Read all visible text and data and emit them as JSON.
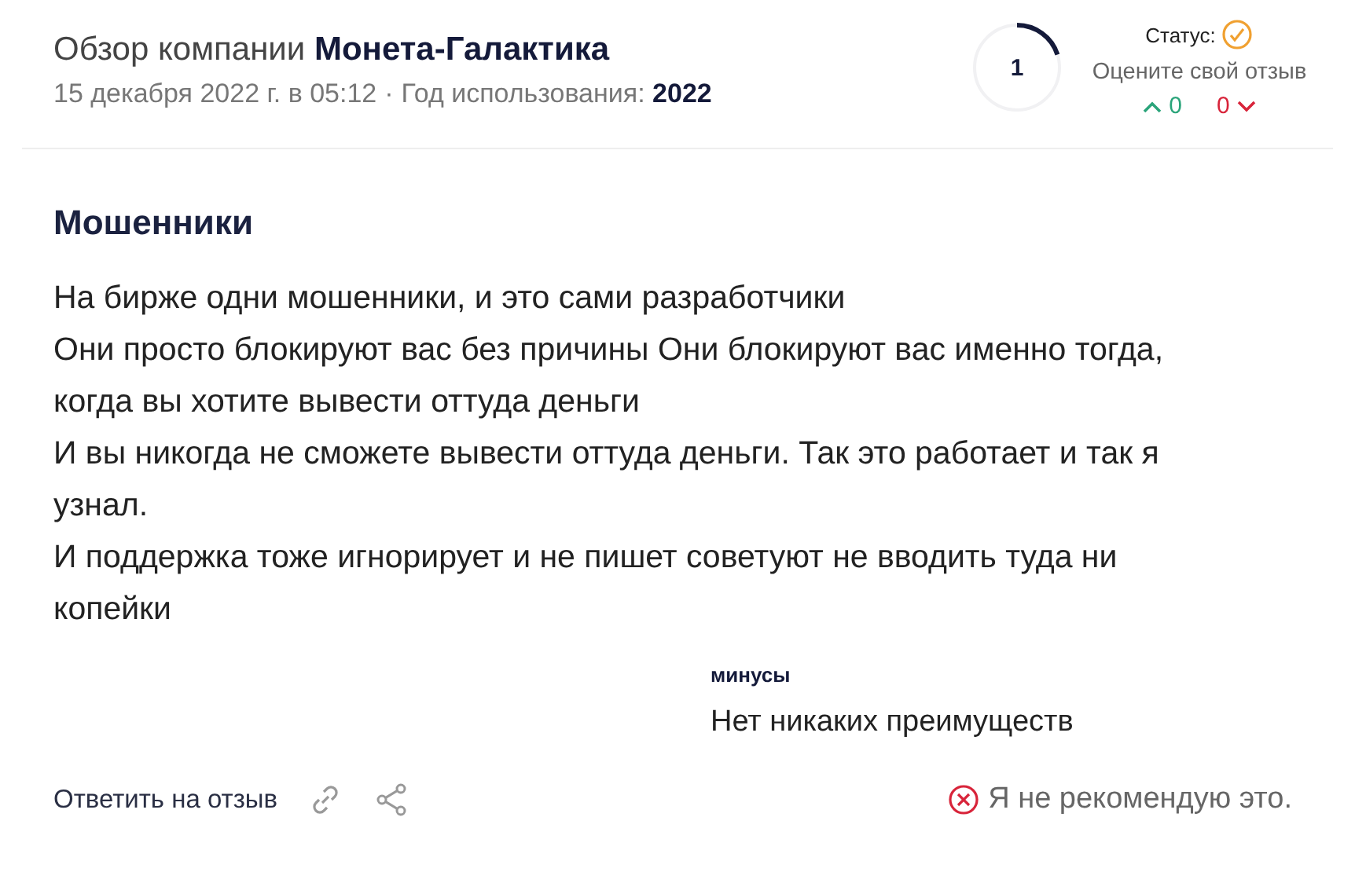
{
  "header": {
    "title_prefix": "Обзор компании",
    "company": "Монета-Галактика",
    "date": "15 декабря 2022 г. в 05:12",
    "separator": "·",
    "year_label": "Год использования:",
    "year": "2022"
  },
  "rating": {
    "value": "1",
    "level": 0.2
  },
  "status": {
    "label": "Статус:",
    "prompt": "Оцените свой отзыв",
    "upvotes": "0",
    "downvotes": "0"
  },
  "review": {
    "title": "Мошенники",
    "paragraphs": [
      "На бирже одни мошенники, и это сами разработчики",
      "Они просто блокируют вас без причины Они блокируют вас именно тогда, когда вы хотите вывести оттуда деньги",
      "И вы никогда не сможете вывести оттуда деньги. Так это работает и так я узнал.",
      "И поддержка тоже игнорирует и не пишет советуют не вводить туда ни копейки"
    ]
  },
  "cons": {
    "heading": "минусы",
    "text": "Нет никаких преимуществ"
  },
  "footer": {
    "reply": "Ответить на отзыв",
    "recommendation": "Я не рекомендую это.",
    "recommended": false
  }
}
